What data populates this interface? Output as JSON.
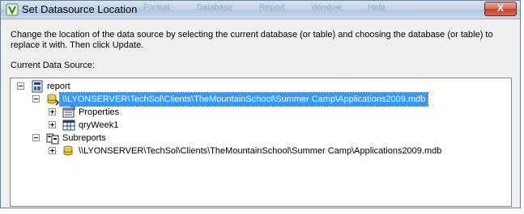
{
  "window": {
    "title": "Set Datasource Location",
    "close_glyph": "X",
    "ghost_menu": [
      "Format",
      "Database",
      "Report",
      "Window",
      "Help"
    ]
  },
  "dialog": {
    "description": "Change the location of the data source by selecting the current database (or table) and choosing the database (or table) to replace it with.  Then click Update.",
    "current_label": "Current Data Source:"
  },
  "tree": {
    "report": {
      "label": "report",
      "icon": "report-icon",
      "expanded": true
    },
    "datasource": {
      "label": "\\\\LYONSERVER\\TechSol\\Clients\\TheMountainSchool\\Summer Camp\\Applications2009.mdb",
      "icon": "database-icon",
      "expanded": true,
      "selected": true
    },
    "properties": {
      "label": "Properties",
      "icon": "properties-icon",
      "expanded": false
    },
    "query": {
      "label": "qryWeek1",
      "icon": "table-icon",
      "expanded": false
    },
    "subreports": {
      "label": "Subreports",
      "icon": "subreports-icon",
      "expanded": true
    },
    "subreport_datasource": {
      "label": "\\\\LYONSERVER\\TechSol\\Clients\\TheMountainSchool\\Summer Camp\\Applications2009.mdb",
      "icon": "database-icon",
      "expanded": false
    }
  },
  "colors": {
    "selection": "#3399ff",
    "dialog_bg": "#f0f0f0",
    "close_button": "#c2402a"
  }
}
